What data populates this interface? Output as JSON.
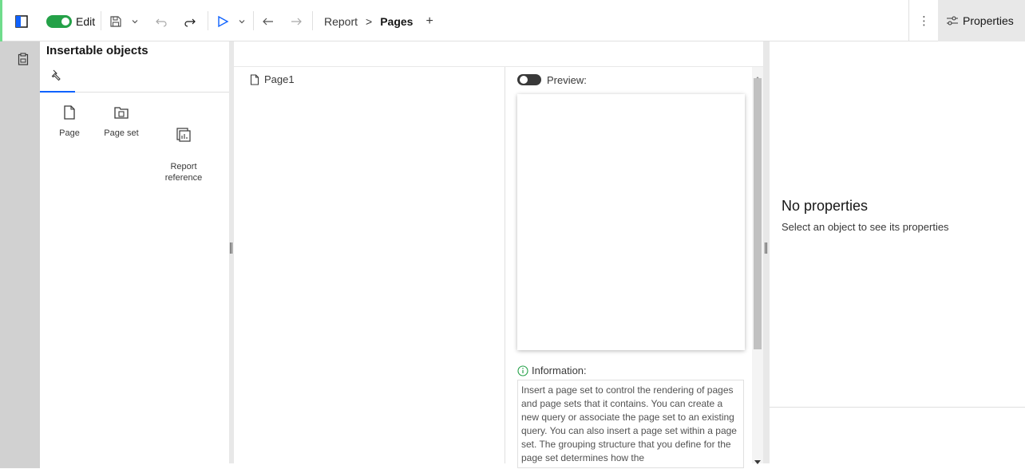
{
  "toolbar": {
    "edit_label": "Edit",
    "breadcrumb": {
      "root": "Report",
      "separator": ">",
      "current": "Pages",
      "add": "+"
    },
    "overflow_label": "⋮",
    "properties_label": "Properties"
  },
  "insertable": {
    "title": "Insertable objects",
    "items": [
      {
        "label": "Page"
      },
      {
        "label": "Page set"
      },
      {
        "label": "Report\nreference"
      }
    ]
  },
  "pages": {
    "page_item": "Page1"
  },
  "preview": {
    "label": "Preview:",
    "info_label": "Information:",
    "info_text": "Insert a page set to control the rendering of pages and page sets that it contains. You can create a new query or associate the page set to an existing query. You can also insert a page set within a page set. The grouping structure that you define for the page set determines how the"
  },
  "properties": {
    "empty_title": "No properties",
    "empty_message": "Select an object to see its properties"
  },
  "colors": {
    "accent_green": "#24a148",
    "toggle_off": "#393939",
    "rail": "#d1d1d1"
  }
}
